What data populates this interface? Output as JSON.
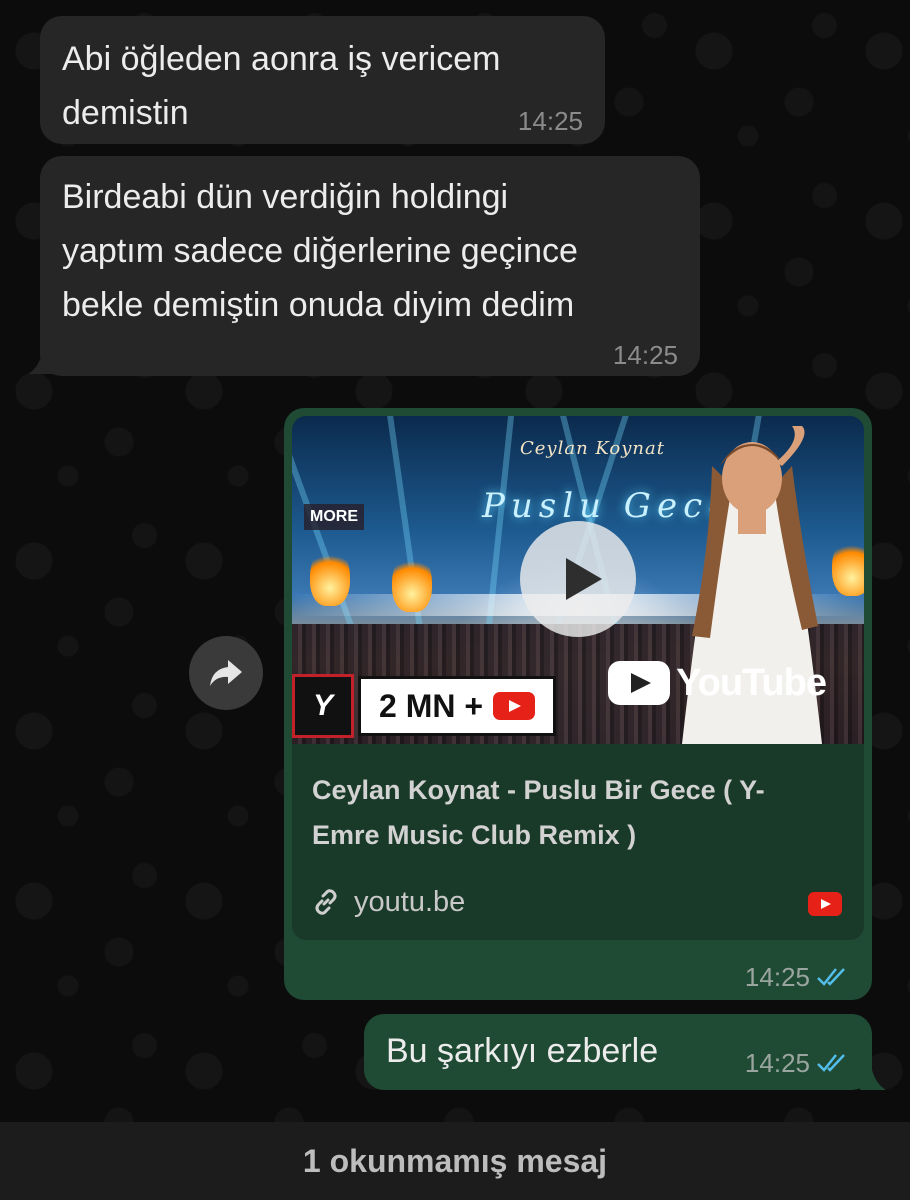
{
  "messages": {
    "m1": {
      "text_line1": "Abi öğleden aonra iş vericem",
      "text_line2": "demistin",
      "time": "14:25"
    },
    "m2": {
      "text_line1": "Birdeabi dün verdiğin holdingi",
      "text_line2": "yaptım sadece diğerlerine geçince",
      "text_line3": "bekle demiştin onuda diyim dedim",
      "time": "14:25"
    },
    "link_card": {
      "thumbnail": {
        "artist_caption": "Ceylan Koynat",
        "title_caption": "Puslu Gece",
        "sign_text": "MORE",
        "badge_logo": "Y",
        "badge_count": "2 MN +",
        "youtube_wordmark": "YouTube"
      },
      "title_line1": "Ceylan Koynat - Puslu Bir Gece ( Y-",
      "title_line2": "Emre Music Club Remix )",
      "domain": "youtu.be",
      "time": "14:25"
    },
    "m4": {
      "text": "Bu şarkıyı ezberle",
      "time": "14:25"
    }
  },
  "unread_banner": "1 okunmamış mesaj",
  "icons": {
    "forward": "forward-icon",
    "link": "link-icon",
    "read_receipt": "double-check-icon",
    "play": "play-icon"
  },
  "colors": {
    "incoming_bubble": "#262626",
    "outgoing_bubble": "#1f4a34",
    "read_tick": "#53bdeb",
    "youtube_red": "#e62117"
  }
}
